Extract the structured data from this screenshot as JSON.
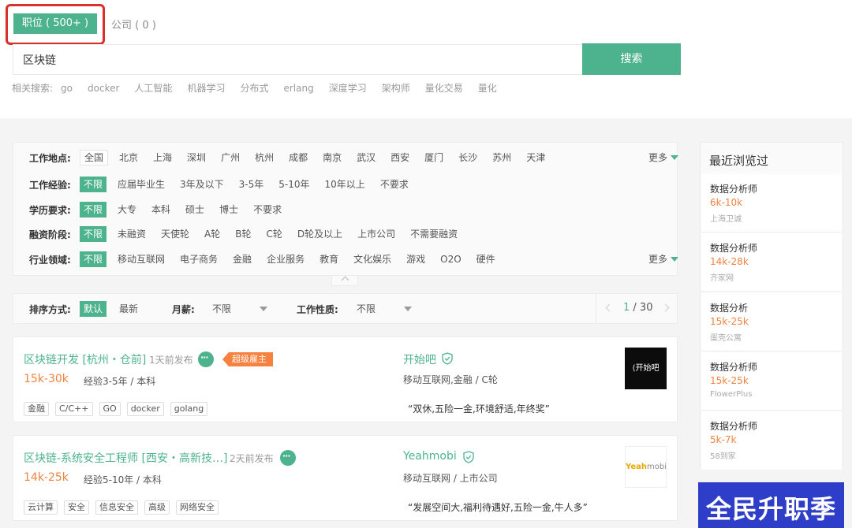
{
  "search_tabs": {
    "jobs": "职位 ( 500+ )",
    "companies": "公司 ( 0 )"
  },
  "search": {
    "value": "区块链",
    "button": "搜索"
  },
  "related": {
    "label": "相关搜索:",
    "items": [
      "go",
      "docker",
      "人工智能",
      "机器学习",
      "分布式",
      "erlang",
      "深度学习",
      "架构师",
      "量化交易",
      "量化"
    ]
  },
  "filters": {
    "more_label": "更多",
    "rows": [
      {
        "label": "工作地点:",
        "options": [
          "全国",
          "北京",
          "上海",
          "深圳",
          "广州",
          "杭州",
          "成都",
          "南京",
          "武汉",
          "西安",
          "厦门",
          "长沙",
          "苏州",
          "天津"
        ]
      },
      {
        "label": "工作经验:",
        "options": [
          "不限",
          "应届毕业生",
          "3年及以下",
          "3-5年",
          "5-10年",
          "10年以上",
          "不要求"
        ]
      },
      {
        "label": "学历要求:",
        "options": [
          "不限",
          "大专",
          "本科",
          "硕士",
          "博士",
          "不要求"
        ]
      },
      {
        "label": "融资阶段:",
        "options": [
          "不限",
          "未融资",
          "天使轮",
          "A轮",
          "B轮",
          "C轮",
          "D轮及以上",
          "上市公司",
          "不需要融资"
        ]
      },
      {
        "label": "行业领域:",
        "options": [
          "不限",
          "移动互联网",
          "电子商务",
          "金融",
          "企业服务",
          "教育",
          "文化娱乐",
          "游戏",
          "O2O",
          "硬件"
        ]
      }
    ]
  },
  "sort": {
    "label": "排序方式:",
    "default": "默认",
    "latest": "最新",
    "salary_label": "月薪:",
    "salary_value": "不限",
    "nature_label": "工作性质:",
    "nature_value": "不限",
    "page_current": "1",
    "page_total": "/ 30"
  },
  "jobs": [
    {
      "title": "区块链开发 [杭州・仓前]",
      "time": "1天前发布",
      "badge": "超级雇主",
      "salary": "15k-30k",
      "requirement": "经验3-5年 / 本科",
      "tags": [
        "金融",
        "C/C++",
        "GO",
        "docker",
        "golang"
      ],
      "company": "开始吧",
      "industry": "移动互联网,金融 / C轮",
      "perk": "“双休,五险一金,环境舒适,年终奖”",
      "logo_text": "⟨开始吧"
    },
    {
      "title": "区块链-系统安全工程师 [西安・高新技…]",
      "time": "2天前发布",
      "salary": "14k-25k",
      "requirement": "经验5-10年 / 本科",
      "tags": [
        "云计算",
        "安全",
        "信息安全",
        "高级",
        "网络安全"
      ],
      "company": "Yeahmobi",
      "industry": "移动互联网 / 上市公司",
      "perk": "“发展空间大,福利待遇好,五险一金,牛人多”",
      "logo_text_y": "Yeah",
      "logo_text_rest": "mobi"
    }
  ],
  "recent": {
    "title": "最近浏览过",
    "items": [
      {
        "title": "数据分析师",
        "salary": "6k-10k",
        "company": "上海卫诚"
      },
      {
        "title": "数据分析师",
        "salary": "14k-28k",
        "company": "齐家网"
      },
      {
        "title": "数据分析",
        "salary": "15k-25k",
        "company": "蛋壳公寓"
      },
      {
        "title": "数据分析师",
        "salary": "15k-25k",
        "company": "FlowerPlus"
      },
      {
        "title": "数据分析师",
        "salary": "5k-7k",
        "company": "58到家"
      }
    ]
  },
  "banner": {
    "text": "全民升职季"
  },
  "colors": {
    "accent": "#4db38e",
    "salary": "#f0833f",
    "highlight_box": "#d9302b"
  }
}
